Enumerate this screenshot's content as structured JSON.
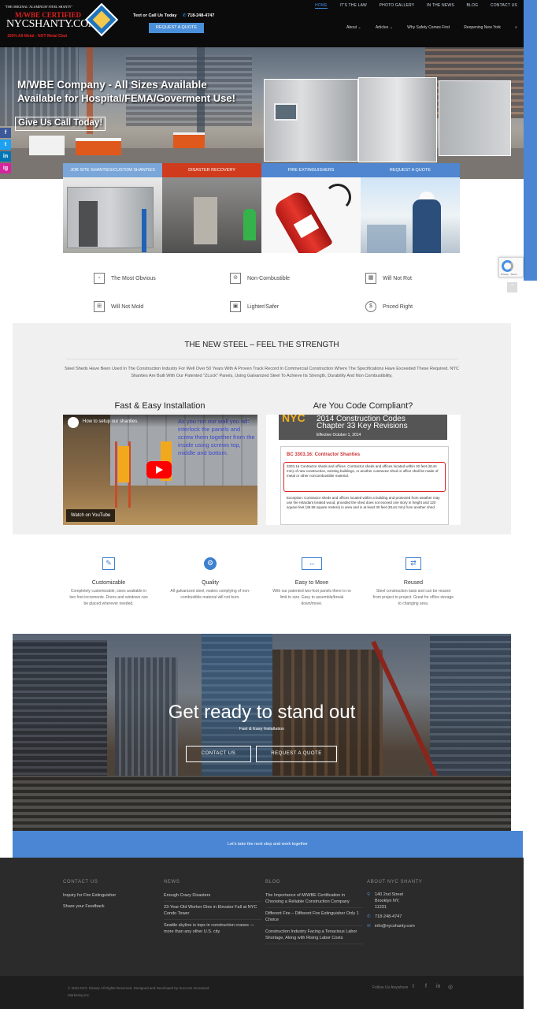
{
  "header": {
    "logo_tagline": "\"THE ORIGINAL 'ALUMINUM' STEEL SHANTY\"",
    "logo_cert": "M/WBE CERTIFIED",
    "logo_brand": "NYCSHANTY.COM",
    "logo_sub": "100% All Metal - NOT Metal Clad",
    "call_label": "Text or Call Us Today",
    "phone": "718-248-4747",
    "quote_button": "REQUEST A QUOTE",
    "top_nav": [
      "HOME",
      "IT'S THE LAW",
      "PHOTO GALLERY",
      "IN THE NEWS",
      "BLOG",
      "CONTACT US"
    ],
    "main_nav": [
      "About",
      "Articles",
      "Why Safety Comes First",
      "Reopening New York"
    ]
  },
  "hero": {
    "line1": "M/WBE Company - All Sizes Available",
    "line2": "Available for Hospital/FEMA/Goverment Use!",
    "cta": "Give Us Call Today!"
  },
  "social_rail": [
    "f",
    "t",
    "in",
    "ig"
  ],
  "services": [
    {
      "label": "JOB SITE SHANTIES/CUSTOM SHANTIES",
      "color": "#7aa6d9"
    },
    {
      "label": "DISASTER RECOVERY",
      "color": "#cf3b1c"
    },
    {
      "label": "FIRE EXTINGUISHERS",
      "color": "#4f86cf"
    },
    {
      "label": "REQUEST A QUOTE",
      "color": "#4f86cf"
    }
  ],
  "features": [
    {
      "icon": "square-icon",
      "label": "The Most Obvious"
    },
    {
      "icon": "no-fire-icon",
      "label": "Non-Combustible"
    },
    {
      "icon": "grid-icon",
      "label": "Will Not Rot"
    },
    {
      "icon": "mold-icon",
      "label": "Will Not Mold"
    },
    {
      "icon": "lock-icon",
      "label": "Lighter/Safer"
    },
    {
      "icon": "dollar-icon",
      "label": "Priced Right"
    }
  ],
  "steel": {
    "heading": "THE NEW STEEL – FEEL THE STRENGTH",
    "paragraph": "Steel Sheds Have Been Used In The Construction Industry For Well Over 50 Years With A Proven Track Record In Commercial Construction Where The Specifications Have Exceeded These Required. NYC Shanties Are Built With Our Patented \"ZLock\" Panels, Using Galvanized Steel To Achieve Its Strength, Durability And Non Combustibility.",
    "left_heading": "Fast & Easy Installation",
    "right_heading": "Are You Code Compliant?",
    "video_title": "How to setup our shanties",
    "video_overlay": "As you run our wall you will interlock the panels and screw them together from the inside using screws top, middle and bottom.",
    "watch_on": "Watch on  YouTube",
    "codes_nyc": "NYC",
    "codes_title1": "2014 Construction Codes",
    "codes_title2": "Chapter 33 Key Revisions",
    "codes_effective": "Effective October 1, 2014",
    "codes_section": "BC 3303.16: Contractor Shanties",
    "codes_box": "3303.16 Contractor sheds and offices. Contractor sheds and offices located within 30 feet (9144 mm) of new construction, existing buildings, or another contractor shed or office shall be made of metal or other noncombustible material.",
    "codes_exception": "Exception: Contractor sheds and offices located within a building and protected from weather may use fire retardant treated wood, provided the shed does not exceed one story in height and 120 square feet (36.58 square meters) in area and is at least 30 feet (9144 mm) from another shed."
  },
  "icon_features": [
    {
      "icon": "pencil-icon",
      "title": "Customizable",
      "text": "Completely customizable, sizes available in two foot increments. Doors and windows can be placed wherever needed."
    },
    {
      "icon": "gear-icon",
      "title": "Quality",
      "text": "All galvanized steel, makes complying of non-combustible material will not burn."
    },
    {
      "icon": "move-icon",
      "title": "Easy to Move",
      "text": "With our patented two-foot panels there is no limit to size. Easy to assemble/break down/move."
    },
    {
      "icon": "reuse-icon",
      "title": "Reused",
      "text": "Steel construction lasts and can be reused from project to project. Great for office storage to changing area."
    }
  ],
  "cta": {
    "heading": "Get ready to stand out",
    "sub": "Fast & Easy Installation",
    "button1": "CONTACT US",
    "button2": "REQUEST A QUOTE",
    "bar": "Let's take the next step and work together"
  },
  "footer": {
    "contact_heading": "CONTACT US",
    "contact_items": [
      "Inquiry for Fire Extinguisher",
      "Share your Feedback"
    ],
    "news_heading": "NEWS",
    "news_items": [
      "Enough Crazy Disasters",
      "23-Year-Old Worker Dies in Elevator Fall at NYC Condo Tower",
      "Seattle skyline is tops in construction cranes — more than any other U.S. city"
    ],
    "blog_heading": "BLOG",
    "blog_items": [
      "The Importance of M/WBE Certification in Choosing a Reliable Construction Company",
      "Different Fire – Different Fire Extinguisher Only 1 Choice",
      "Construction Industry Facing a Tenacious Labor Shortage, Along with Rising Labor Costs"
    ],
    "about_heading": "ABOUT NYC SHANTY",
    "address1": "140 2nd Street",
    "address2": "Brooklyn NY,",
    "address3": "11231",
    "phone": "718-248-4747",
    "email": "info@nycshanty.com",
    "copyright": "© 2023 NYC Shanty All Rights Reserved. Designed and Developed by Success Increased Marketing Inc.",
    "follow": "Follow Us Anywhere"
  }
}
